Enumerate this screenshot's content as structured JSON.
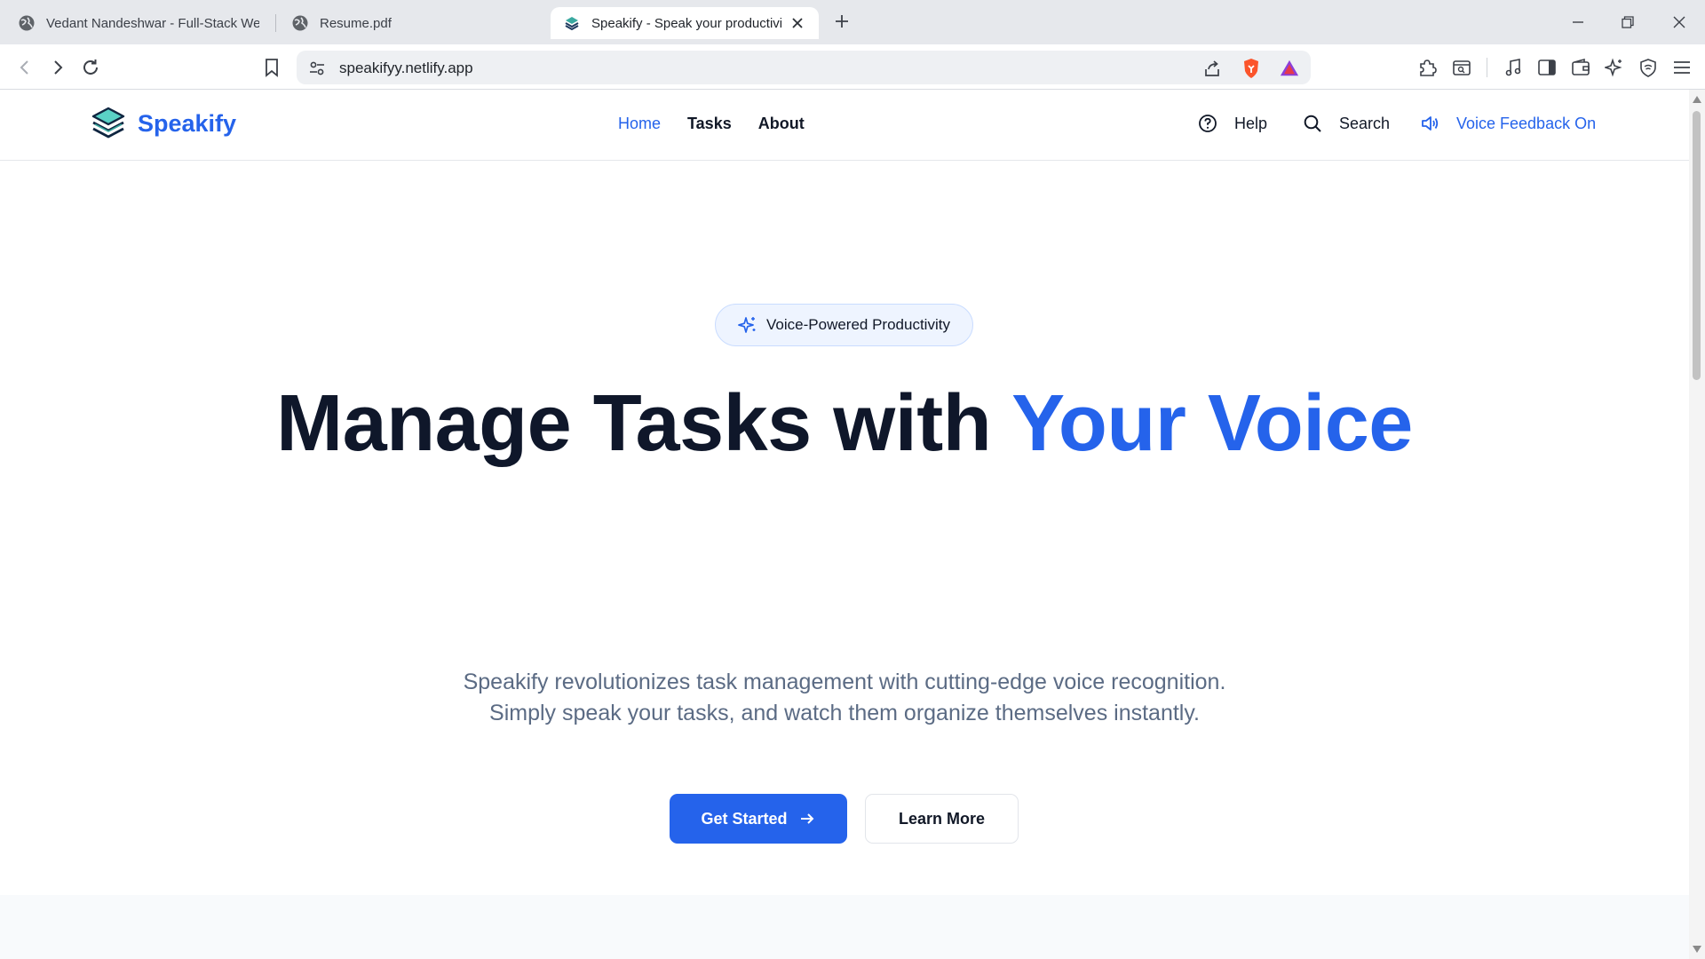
{
  "browser": {
    "tabs": [
      {
        "title": "Vedant Nandeshwar - Full-Stack Web",
        "icon": "globe-icon"
      },
      {
        "title": "Resume.pdf",
        "icon": "globe-icon"
      },
      {
        "title": "Speakify - Speak your productivi",
        "icon": "speakify-favicon",
        "active": true
      }
    ],
    "url": "speakifyy.netlify.app"
  },
  "navbar": {
    "brand": "Speakify",
    "links": [
      {
        "label": "Home",
        "active": true
      },
      {
        "label": "Tasks"
      },
      {
        "label": "About"
      }
    ],
    "help": "Help",
    "search": "Search",
    "voice_feedback": "Voice Feedback On"
  },
  "hero": {
    "badge": "Voice-Powered Productivity",
    "headline_main": "Manage Tasks with ",
    "headline_accent": "Your Voice",
    "subtitle": "Speakify revolutionizes task management with cutting-edge voice recognition. Simply speak your tasks, and watch them organize themselves instantly.",
    "primary_cta": "Get Started",
    "secondary_cta": "Learn More"
  },
  "colors": {
    "accent": "#2563eb",
    "heading": "#0f172a",
    "muted": "#5b6b84"
  }
}
